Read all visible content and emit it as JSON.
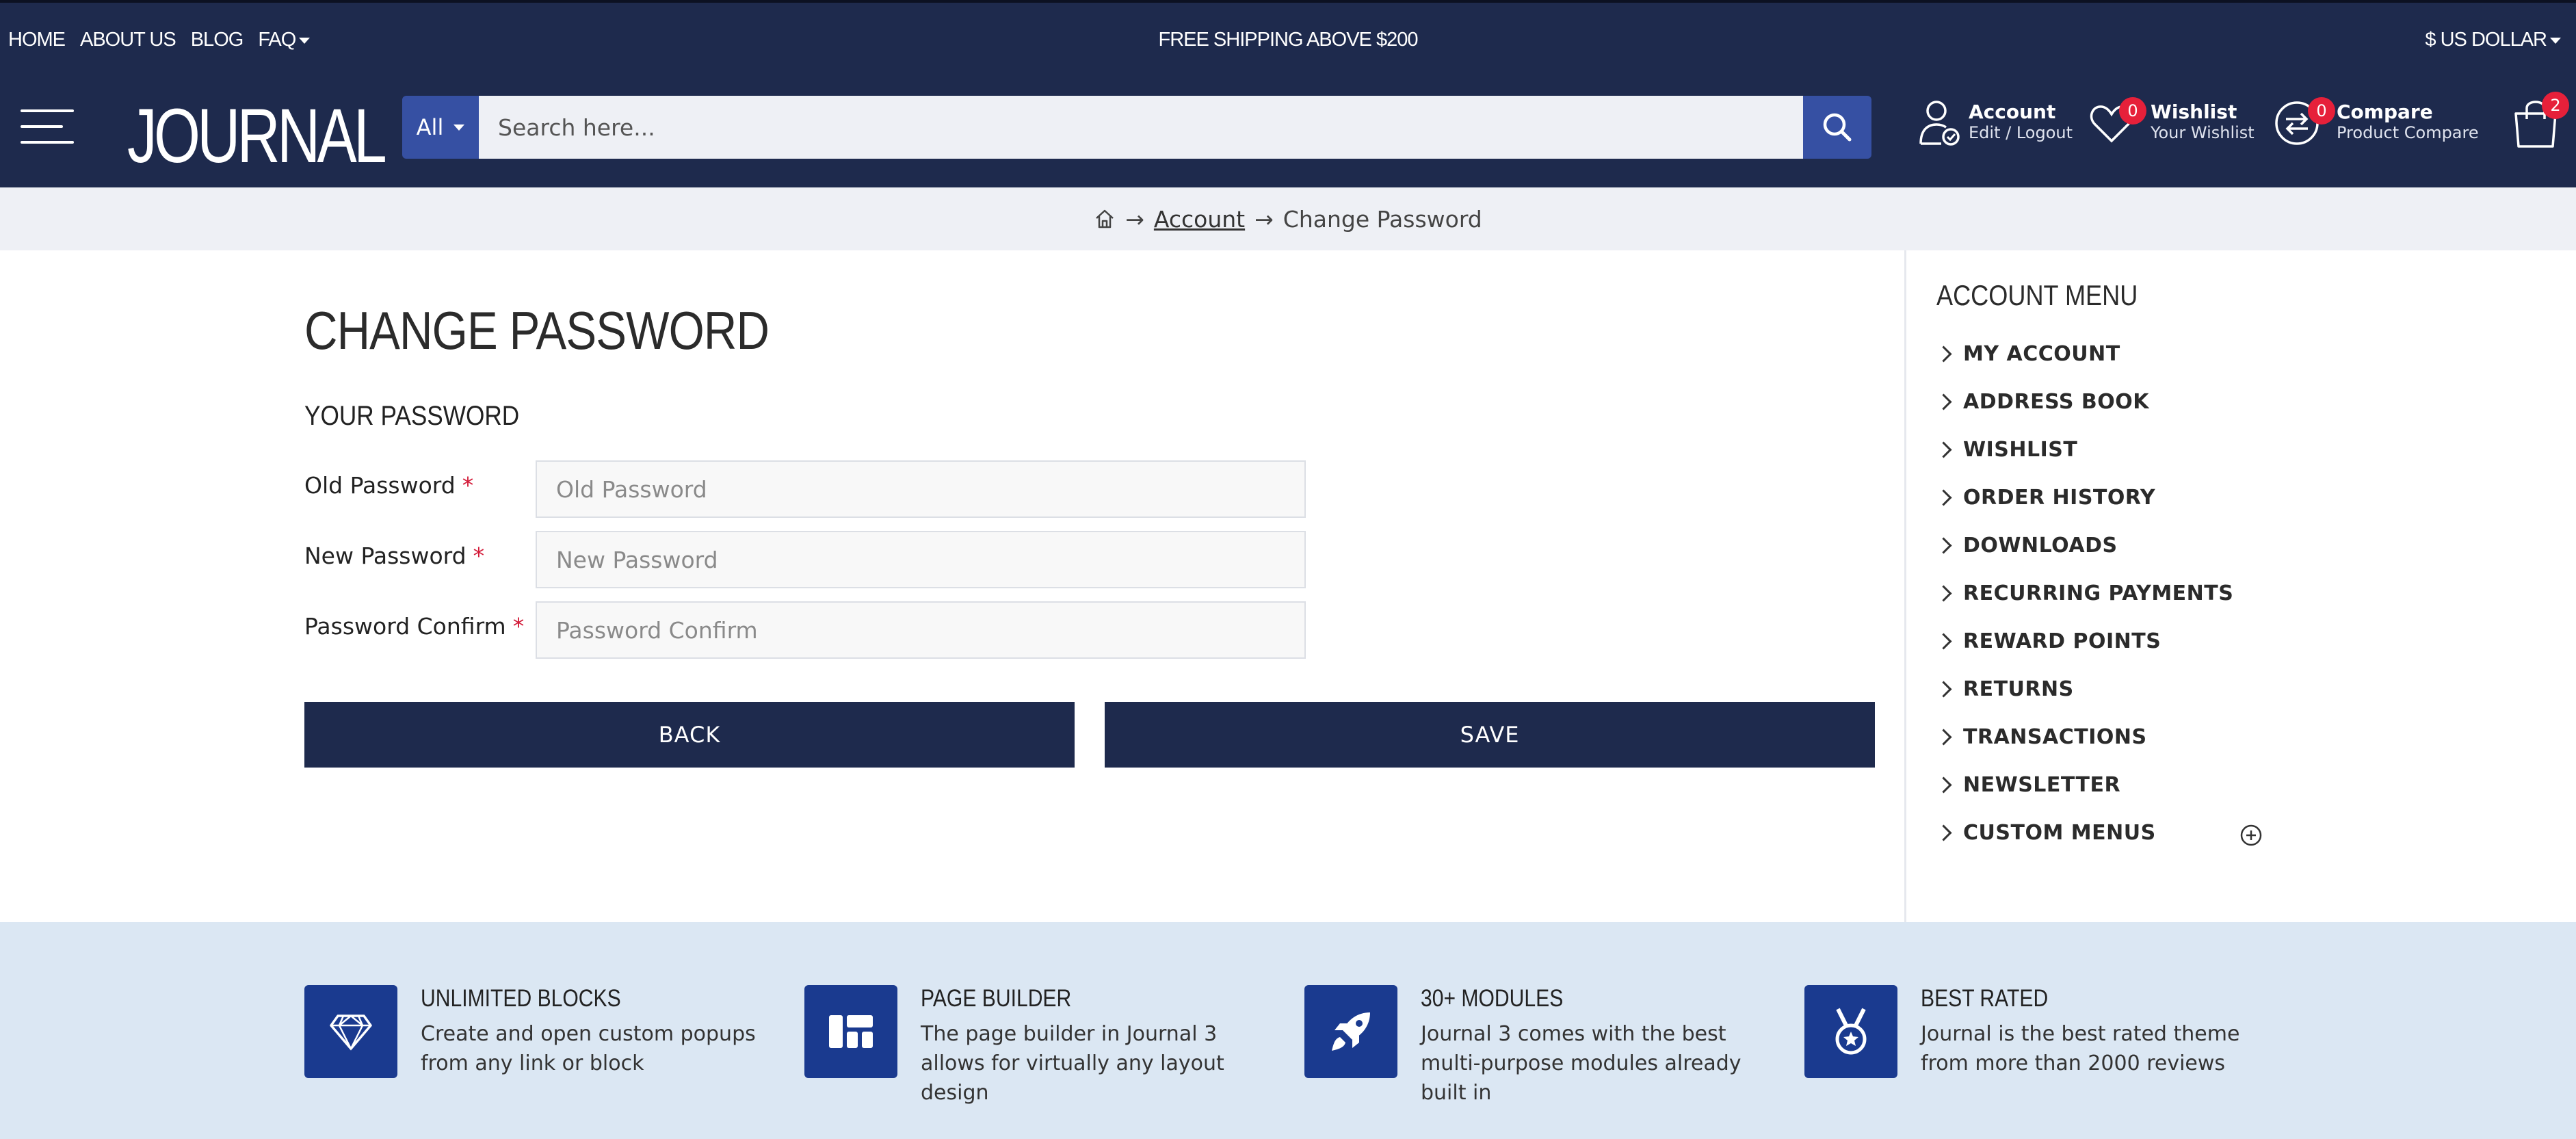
{
  "topbar": {
    "nav": [
      "HOME",
      "ABOUT US",
      "BLOG",
      "FAQ"
    ],
    "promo": "FREE SHIPPING ABOVE $200",
    "currency": "$ US DOLLAR"
  },
  "header": {
    "logo": "JOURNAL",
    "search": {
      "category": "All",
      "placeholder": "Search here..."
    },
    "account": {
      "title": "Account",
      "subtitle": "Edit / Logout"
    },
    "wishlist": {
      "title": "Wishlist",
      "subtitle": "Your Wishlist",
      "count": "0"
    },
    "compare": {
      "title": "Compare",
      "subtitle": "Product Compare",
      "count": "0"
    },
    "cart": {
      "count": "2"
    }
  },
  "breadcrumb": {
    "items": [
      "Account",
      "Change Password"
    ],
    "separator": "→"
  },
  "page": {
    "title": "CHANGE PASSWORD",
    "section": "YOUR PASSWORD",
    "fields": [
      {
        "label": "Old Password",
        "placeholder": "Old Password",
        "required": "*"
      },
      {
        "label": "New Password",
        "placeholder": "New Password",
        "required": "*"
      },
      {
        "label": "Password Confirm",
        "placeholder": "Password Confirm",
        "required": "*"
      }
    ],
    "back_label": "BACK",
    "save_label": "SAVE"
  },
  "sidebar": {
    "title": "ACCOUNT MENU",
    "items": [
      "MY ACCOUNT",
      "ADDRESS BOOK",
      "WISHLIST",
      "ORDER HISTORY",
      "DOWNLOADS",
      "RECURRING PAYMENTS",
      "REWARD POINTS",
      "RETURNS",
      "TRANSACTIONS",
      "NEWSLETTER",
      "CUSTOM MENUS"
    ]
  },
  "features": [
    {
      "icon": "diamond-icon",
      "title": "UNLIMITED BLOCKS",
      "text": "Create and open custom popups from any link or block"
    },
    {
      "icon": "layout-icon",
      "title": "PAGE BUILDER",
      "text": "The page builder in Journal 3 allows for virtually any layout design"
    },
    {
      "icon": "rocket-icon",
      "title": "30+ MODULES",
      "text": "Journal 3 comes with the best multi-purpose modules already built in"
    },
    {
      "icon": "medal-icon",
      "title": "BEST RATED",
      "text": "Journal is the best rated theme from more than 2000 reviews"
    }
  ],
  "colors": {
    "navy": "#1e2a4d",
    "accent": "#3650a3",
    "badge": "#e6203a",
    "feature_icon_bg": "#1a3a8f"
  }
}
